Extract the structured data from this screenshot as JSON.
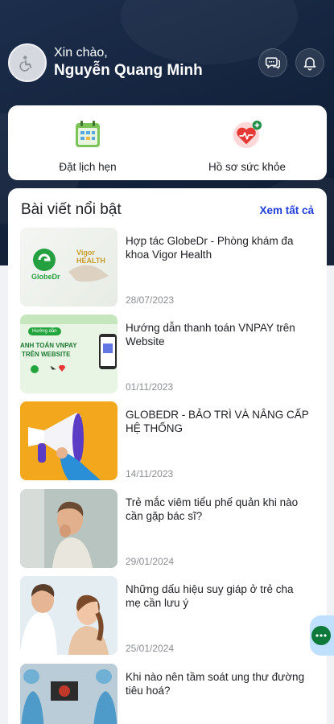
{
  "header": {
    "greeting": "Xin chào,",
    "user_name": "Nguyễn Quang Minh",
    "avatar_icon": "user-avatar-icon",
    "chat_icon": "chat-bubble-icon",
    "bell_icon": "bell-icon"
  },
  "quick_actions": [
    {
      "label": "Đặt lịch hẹn",
      "icon": "calendar-appointment-icon"
    },
    {
      "label": "Hồ sơ sức khỏe",
      "icon": "health-record-icon"
    }
  ],
  "featured": {
    "title": "Bài viết nổi bật",
    "see_all": "Xem tất cả",
    "articles": [
      {
        "title": "Hợp tác GlobeDr - Phòng khám đa khoa Vigor Health",
        "date": "28/07/2023",
        "thumb_text": [
          "GlobeDr",
          "Vigor HEALTH"
        ]
      },
      {
        "title": "Hướng dẫn thanh toán VNPAY trên Website",
        "date": "01/11/2023",
        "thumb_text": [
          "Hướng dẫn",
          "ANH TOÁN VNPAY",
          "TRÊN WEBSITE"
        ]
      },
      {
        "title": "GLOBEDR - BẢO TRÌ VÀ NÂNG CẤP HỆ THỐNG",
        "date": "14/11/2023"
      },
      {
        "title": "Trẻ mắc viêm tiểu phế quản khi nào cần gặp bác sĩ?",
        "date": "29/01/2024"
      },
      {
        "title": "Những dấu hiệu suy giáp ở trẻ cha mẹ cần lưu ý",
        "date": "25/01/2024"
      },
      {
        "title": "Khi nào nên tầm soát ung thư đường tiêu hoá?",
        "date": ""
      }
    ]
  },
  "floating_chat": {
    "icon": "chat-dots-icon"
  },
  "colors": {
    "header_bg": "#13223b",
    "link": "#1f3dd8",
    "brand_green": "#0d7a3b"
  }
}
